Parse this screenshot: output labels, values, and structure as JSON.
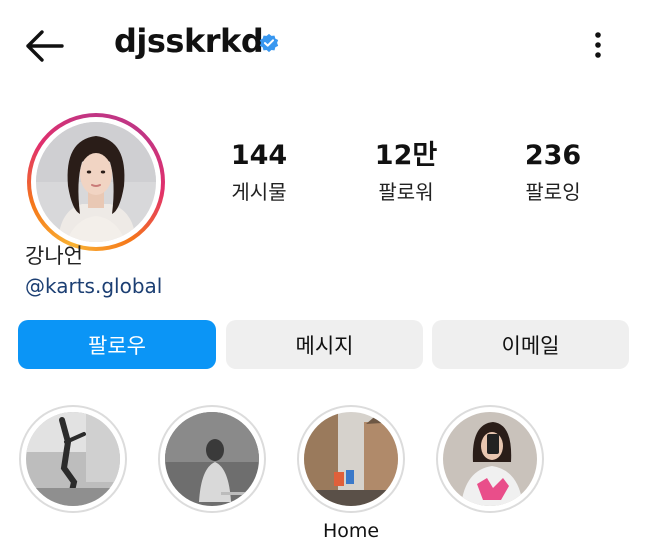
{
  "header": {
    "back_icon": "arrow-left-icon",
    "username": "djsskrkd",
    "verified_icon": "verified-badge-icon",
    "verified_color": "#3897f0",
    "more_icon": "more-vertical-icon"
  },
  "profile": {
    "avatar_icon": "profile-photo",
    "display_name": "강나언",
    "bio_link": "@karts.global",
    "stats": {
      "posts": {
        "value": "144",
        "label": "게시물"
      },
      "followers": {
        "value": "12만",
        "label": "팔로워"
      },
      "following": {
        "value": "236",
        "label": "팔로잉"
      }
    }
  },
  "actions": {
    "follow_label": "팔로우",
    "message_label": "메시지",
    "email_label": "이메일",
    "follow_color": "#0b95f6"
  },
  "highlights": [
    {
      "label": ""
    },
    {
      "label": ""
    },
    {
      "label": "Home"
    },
    {
      "label": ""
    }
  ]
}
